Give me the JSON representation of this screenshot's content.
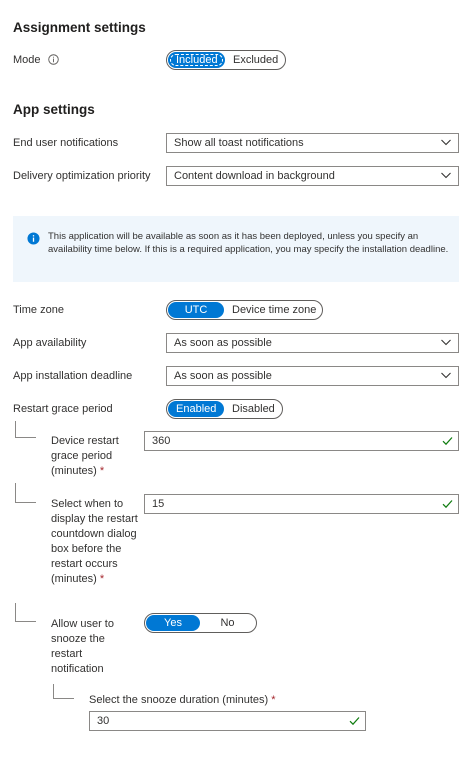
{
  "assignment": {
    "title": "Assignment settings",
    "mode_label": "Mode",
    "mode_options": [
      "Included",
      "Excluded"
    ],
    "mode_selected": "Included"
  },
  "app_settings": {
    "title": "App settings",
    "notifications_label": "End user notifications",
    "notifications_value": "Show all toast notifications",
    "delivery_label": "Delivery optimization priority",
    "delivery_value": "Content download in background"
  },
  "banner": {
    "text": "This application will be available as soon as it has been deployed, unless you specify an availability time below. If this is a required application, you may specify the installation deadline."
  },
  "timezone": {
    "label": "Time zone",
    "options": [
      "UTC",
      "Device time zone"
    ],
    "selected": "UTC"
  },
  "availability": {
    "label": "App availability",
    "value": "As soon as possible"
  },
  "deadline": {
    "label": "App installation deadline",
    "value": "As soon as possible"
  },
  "restart": {
    "label": "Restart grace period",
    "options": [
      "Enabled",
      "Disabled"
    ],
    "selected": "Enabled",
    "grace_label": "Device restart grace period (minutes)",
    "grace_value": "360",
    "countdown_label": "Select when to display the restart countdown dialog box before the restart occurs (minutes)",
    "countdown_value": "15",
    "snooze_label": "Allow user to snooze the restart notification",
    "snooze_options": [
      "Yes",
      "No"
    ],
    "snooze_selected": "Yes",
    "snooze_duration_label": "Select the snooze duration (minutes)",
    "snooze_duration_value": "30"
  },
  "required_marker": "*",
  "colors": {
    "accent": "#0078d4",
    "valid": "#107c10",
    "required": "#a4262c",
    "banner_bg": "#eff6fc"
  }
}
